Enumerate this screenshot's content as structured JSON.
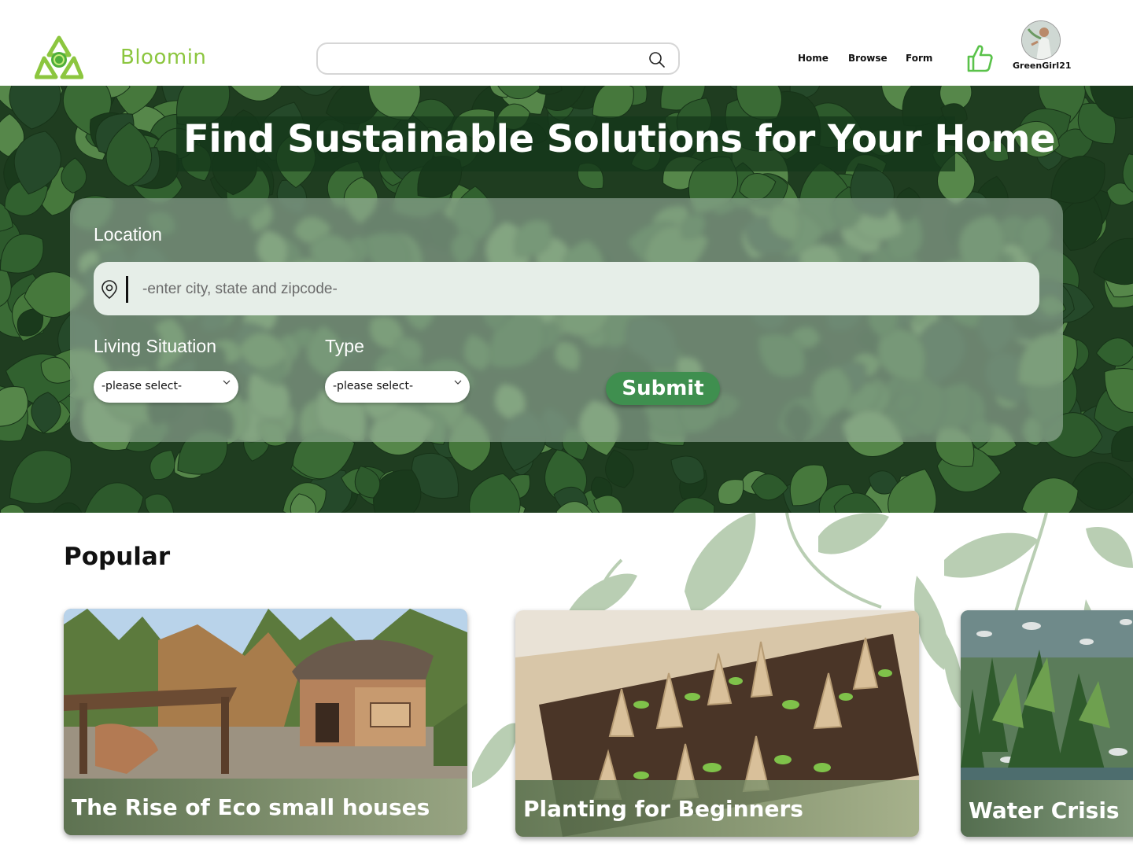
{
  "header": {
    "brand": "Bloomin",
    "search": {
      "value": "",
      "placeholder": ""
    },
    "nav": [
      {
        "label": "Home"
      },
      {
        "label": "Browse"
      },
      {
        "label": "Form"
      }
    ],
    "username": "GreenGirl21"
  },
  "hero": {
    "title": "Find Sustainable Solutions for Your Home",
    "form": {
      "location_label": "Location",
      "location_placeholder": "-enter city, state and zipcode-",
      "location_value": "",
      "living_label": "Living Situation",
      "living_value": "-please select-",
      "type_label": "Type",
      "type_value": "-please select-",
      "submit_label": "Submit"
    }
  },
  "popular": {
    "title": "Popular",
    "cards": [
      {
        "title": "The Rise of Eco small houses"
      },
      {
        "title": "Planting for Beginners"
      },
      {
        "title": "Water Crisis"
      }
    ]
  },
  "colors": {
    "brand": "#8cc63f",
    "accent": "#3f8f4f",
    "leaf_light": "#b9ceb3",
    "ivy_dark": "#1e3a1f"
  },
  "icons": [
    "recycle-logo-icon",
    "search-icon",
    "thumbs-up-icon",
    "location-pin-icon",
    "chevron-down-icon"
  ]
}
